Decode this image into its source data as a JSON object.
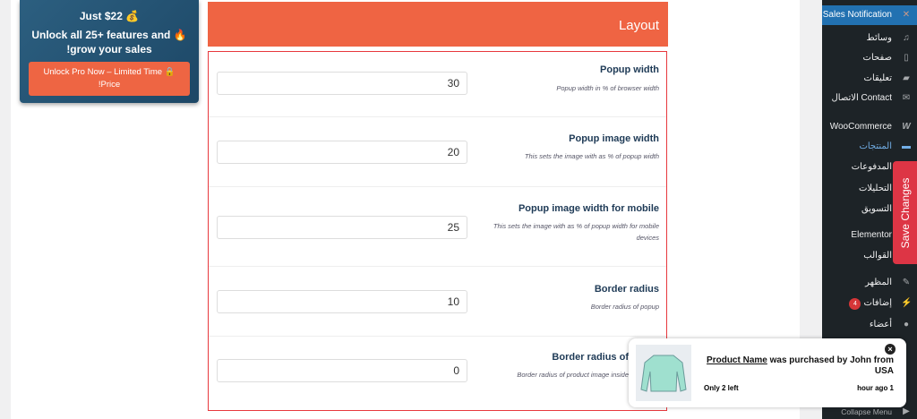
{
  "promo": {
    "price": "Just $22 💰",
    "line": "Unlock all 25+ features and 🔥 !grow your sales",
    "button": "Unlock Pro Now – Limited Time 🔒 !Price"
  },
  "header": {
    "title": "Layout"
  },
  "fields": [
    {
      "label": "Popup width",
      "desc": "Popup width in % of browser width",
      "value": "30"
    },
    {
      "label": "Popup image width",
      "desc": "This sets the image with as % of popup width",
      "value": "20"
    },
    {
      "label": "Popup image width for mobile",
      "desc": "This sets the image with as % of popup width for mobile devices",
      "value": "25"
    },
    {
      "label": "Border radius",
      "desc": "Border radius of popup",
      "value": "10"
    },
    {
      "label": "Border radius of",
      "desc": "Border radius of product image inside",
      "value": "0"
    }
  ],
  "sidebar": {
    "items": [
      {
        "label": "Sales Notification",
        "icon": "plugin-icon"
      },
      {
        "label": "وسائط",
        "icon": "media-icon"
      },
      {
        "label": "صفحات",
        "icon": "pages-icon"
      },
      {
        "label": "تعليقات",
        "icon": "comments-icon"
      },
      {
        "label": "الاتصال Contact",
        "icon": "mail-icon"
      },
      {
        "label": "WooCommerce",
        "icon": "woo-icon"
      },
      {
        "label": "المنتجات",
        "icon": "products-icon"
      },
      {
        "label": "المدفوعات",
        "icon": ""
      },
      {
        "label": "التحليلات",
        "icon": ""
      },
      {
        "label": "التسويق",
        "icon": ""
      },
      {
        "label": "Elementor",
        "icon": ""
      },
      {
        "label": "القوالب",
        "icon": ""
      },
      {
        "label": "المظهر",
        "icon": "appearance-icon"
      },
      {
        "label": "إضافات",
        "icon": "plugins-icon",
        "badge": "4"
      },
      {
        "label": "أعضاء",
        "icon": "users-icon"
      },
      {
        "label": "Collapse Menu",
        "icon": "collapse-icon"
      }
    ]
  },
  "save": {
    "label": "Save Changes"
  },
  "popup": {
    "product": "Product Name",
    "message": " was purchased by John from USA",
    "stock": "Only 2 left",
    "time": "hour ago 1"
  }
}
